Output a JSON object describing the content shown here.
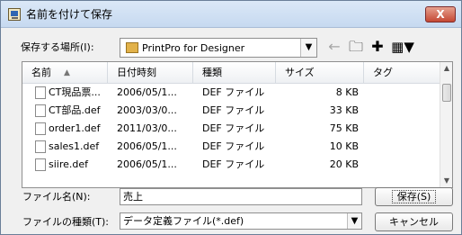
{
  "window": {
    "title": "名前を付けて保存",
    "close_label": "X"
  },
  "location": {
    "label": "保存する場所(I):",
    "value": "PrintPro for Designer"
  },
  "toolbar": {
    "back_icon": "back-arrow-icon",
    "up_icon": "up-folder-icon",
    "new_folder_icon": "new-folder-icon",
    "view_icon": "view-menu-icon"
  },
  "list": {
    "headers": [
      "名前",
      "日付時刻",
      "種類",
      "サイズ",
      "タグ"
    ],
    "rows": [
      {
        "name": "CT現品票...",
        "date": "2006/05/1...",
        "type": "DEF ファイル",
        "size": "8 KB"
      },
      {
        "name": "CT部品.def",
        "date": "2003/03/0...",
        "type": "DEF ファイル",
        "size": "33 KB"
      },
      {
        "name": "order1.def",
        "date": "2011/03/0...",
        "type": "DEF ファイル",
        "size": "75 KB"
      },
      {
        "name": "sales1.def",
        "date": "2006/05/1...",
        "type": "DEF ファイル",
        "size": "10 KB"
      },
      {
        "name": "siire.def",
        "date": "2006/05/1...",
        "type": "DEF ファイル",
        "size": "20 KB"
      }
    ]
  },
  "filename": {
    "label": "ファイル名(N):",
    "value": "売上"
  },
  "filetype": {
    "label": "ファイルの種類(T):",
    "value": "データ定義ファイル(*.def)"
  },
  "buttons": {
    "save": "保存(S)",
    "cancel": "キャンセル"
  }
}
